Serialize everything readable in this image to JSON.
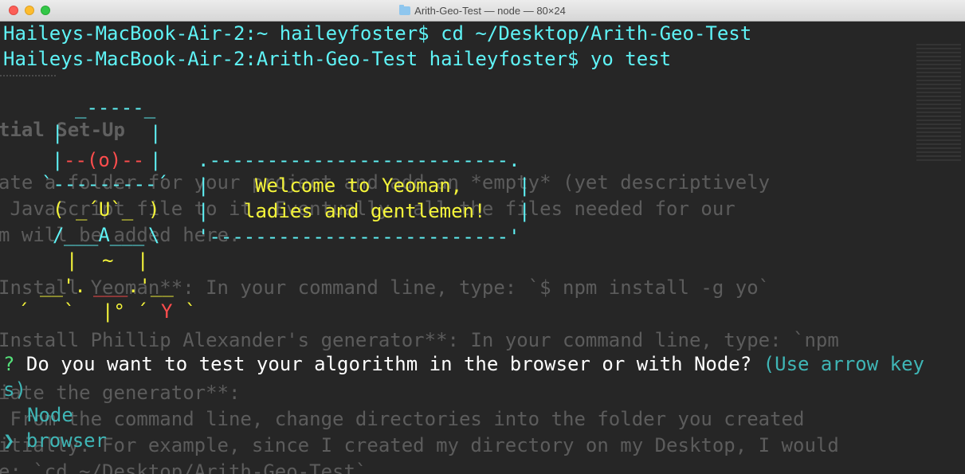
{
  "window": {
    "title": "Arith-Geo-Test — node — 80×24"
  },
  "background_doc": {
    "lines": [
      {
        "text": "tial Set-Up",
        "bold": true
      },
      {
        "text": "ate a folder for your project and add an *empty* (yet descriptively"
      },
      {
        "text": " JavaScript file to it. Eventually, all the files needed for our"
      },
      {
        "text": "m will be added here."
      },
      {
        "text": "Install Yeoman**: In your command line, type: `$ npm install -g yo`"
      },
      {
        "text": "Install Phillip Alexander's generator**: In your command line, type: `npm"
      },
      {
        "text": "iate the generator**:"
      },
      {
        "text": " From the command line, change directories into the folder you created"
      },
      {
        "text": "itially. For example, since I created my directory on my Desktop, I would"
      },
      {
        "text": "e: `cd ~/Desktop/Arith-Geo-Test`"
      }
    ]
  },
  "terminal": {
    "cmd1": "Haileys-MacBook-Air-2:~ haileyfoster$ cd ~/Desktop/Arith-Geo-Test",
    "cmd2": "Haileys-MacBook-Air-2:Arith-Geo-Test haileyfoster$ yo test",
    "yeoman": {
      "r1": "_-----_",
      "r2a": "|",
      "r2b": "|",
      "r3a": "|",
      "r3b": "--(o)--",
      "r3c": "|",
      "r4": "`---------´",
      "r5a": "(",
      "r5b": "_´U`_",
      "r5c": ")",
      "r6a": "/",
      "r6b": "___A___",
      "r6c": "\\",
      "r7a": "|",
      "r7b": "~",
      "r7c": "|",
      "r8a": "__'.",
      "r8b": "___",
      "r8c": ".'__",
      "r9a": "´   `",
      "r9b": "|° ´",
      "r9c": "Y",
      "r9d": "`"
    },
    "bubble": {
      "top": ".--------------------------.",
      "left1": "|",
      "left2": "|",
      "right1": "|",
      "right2": "|",
      "msg1": "Welcome to Yeoman,",
      "msg2": "ladies and gentlemen!",
      "bottom": "'--------------------------'"
    },
    "question_mark": "?",
    "question": "Do you want to test your algorithm in the browser or with Node?",
    "hint_part1": "(Use arrow key",
    "hint_part2": "s)",
    "options": [
      "Node",
      "browser"
    ],
    "pointer": "❯",
    "selected_option": "browser"
  }
}
